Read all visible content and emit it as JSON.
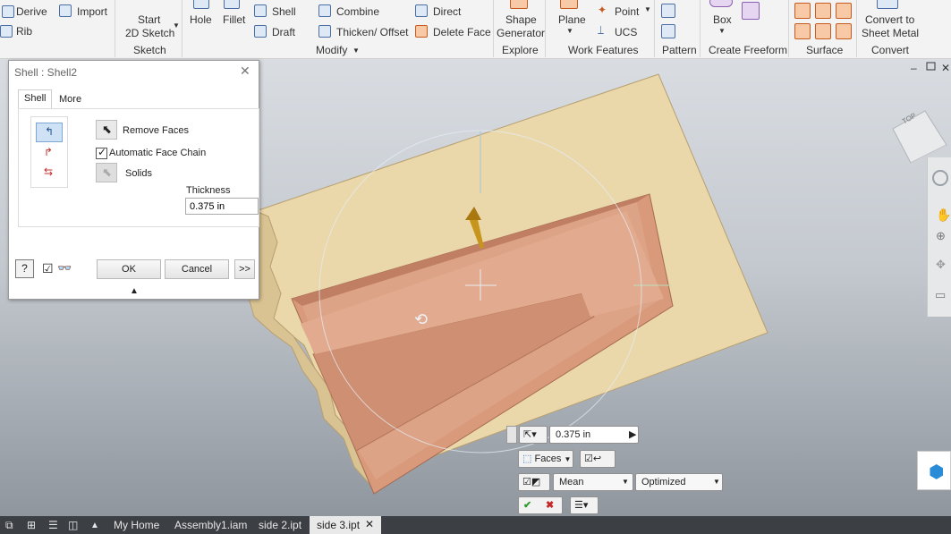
{
  "ribbon": {
    "derive": "Derive",
    "import": "Import",
    "rib": "Rib",
    "start_sketch_1": "Start",
    "start_sketch_2": "2D Sketch",
    "hole": "Hole",
    "fillet": "Fillet",
    "shell": "Shell",
    "draft": "Draft",
    "combine": "Combine",
    "thicken": "Thicken/ Offset",
    "direct": "Direct",
    "delete_face": "Delete Face",
    "shape_gen_1": "Shape",
    "shape_gen_2": "Generator",
    "plane": "Plane",
    "point": "Point",
    "ucs": "UCS",
    "box": "Box",
    "convert_1": "Convert to",
    "convert_2": "Sheet Metal",
    "groups": {
      "sketch": "Sketch",
      "modify": "Modify",
      "explore": "Explore",
      "work_features": "Work Features",
      "pattern": "Pattern",
      "create_freeform": "Create Freeform",
      "surface": "Surface",
      "convert": "Convert"
    }
  },
  "dialog": {
    "title": "Shell : Shell2",
    "tabs": [
      "Shell",
      "More"
    ],
    "remove_faces": "Remove Faces",
    "automatic_face_chain": "Automatic Face Chain",
    "automatic_face_chain_checked": true,
    "solids": "Solids",
    "thickness_label": "Thickness",
    "thickness_value": "0.375 in",
    "ok": "OK",
    "cancel": "Cancel",
    "more": ">>"
  },
  "minitoolbar": {
    "thickness": "0.375 in",
    "faces": "Faces",
    "mean": "Mean",
    "optimized": "Optimized"
  },
  "viewcube": {
    "label": "TOP"
  },
  "statusbar": {
    "tabs": [
      "My Home",
      "Assembly1.iam",
      "side 2.ipt",
      "side 3.ipt"
    ],
    "active_tab": "side 3.ipt"
  },
  "colors": {
    "part": "#ead7aa",
    "pocket": "#d79b7e",
    "accent": "#2a6db5"
  }
}
